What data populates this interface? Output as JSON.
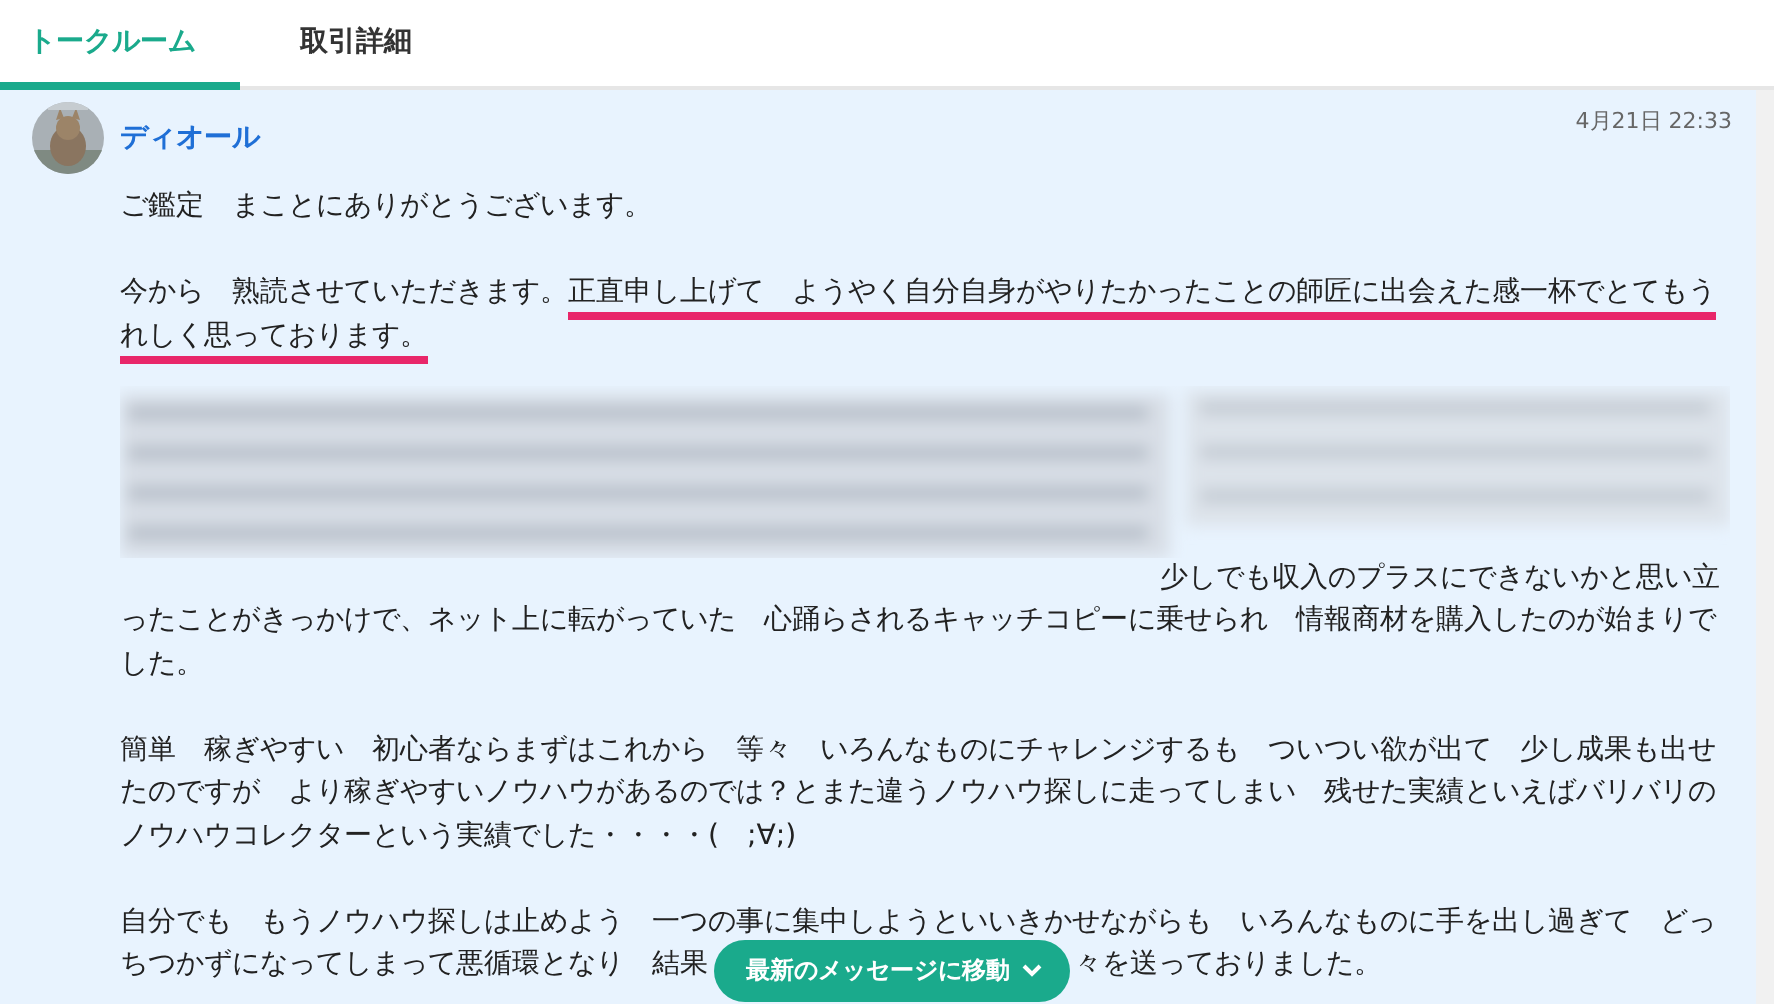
{
  "tabs": [
    {
      "label": "トークルーム",
      "selected": true
    },
    {
      "label": "取引詳細",
      "selected": false
    }
  ],
  "message": {
    "author": "ディオール",
    "time": "4月21日 22:33",
    "paragraphs": [
      {
        "kind": "text",
        "text": "ご鑑定　まことにありがとうございます。"
      },
      {
        "kind": "text",
        "text": "今から　熟読させていただきます。",
        "underlined_text": "正直申し上げて　ようやく自分自身がやりたかったことの師匠に出会えた感一杯でとてもうれしく思っております。"
      },
      {
        "kind": "blurred",
        "text": "少しでも収入のプラスにできないかと思い立ったことがきっかけで、ネット上に転がっていた　心踊らされるキャッチコピーに乗せられ　情報商材を購入したのが始まりでした。"
      },
      {
        "kind": "text",
        "text": "簡単　稼ぎやすい　初心者ならまずはこれから　等々　いろんなものにチャレンジするも　ついつい欲が出て　少し成果も出せたのですが　より稼ぎやすいノウハウがあるのでは？とまた違うノウハウ探しに走ってしまい　残せた実績といえばバリバリのノウハウコレクターという実績でした・・・・(　;∀;)"
      },
      {
        "kind": "covered",
        "text": "自分でも　もうノウハウ探しは止めよう　一つの事に集中しようといいきかせながらも　いろんなものに手を出し過ぎて　どっ",
        "line_2": "ちつかずになってしまって悪循環となり　結果",
        "tail": "々を送っておりました。"
      }
    ]
  },
  "jump_button": {
    "label": "最新のメッセージに移動"
  }
}
